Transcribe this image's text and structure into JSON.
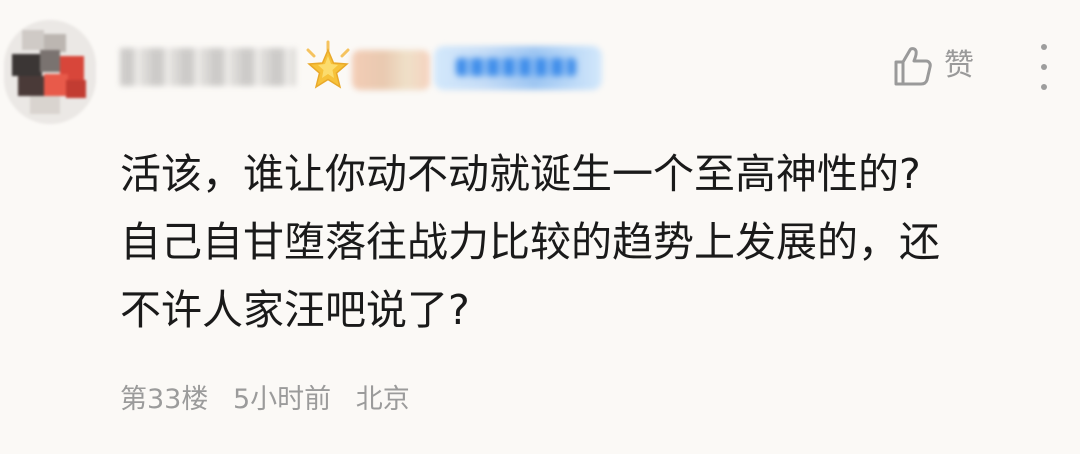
{
  "comment": {
    "username": "",
    "like_label": "赞",
    "content_lines": [
      "活该，谁让你动不动就诞生一个至高神性的?",
      "自己自甘堕落往战力比较的趋势上发展的，还",
      "不许人家汪吧说了?"
    ],
    "floor": "第33楼",
    "time": "5小时前",
    "location": "北京",
    "icons": {
      "like": "thumbs-up-icon",
      "more": "more-vertical-icon",
      "badge": "star-icon"
    },
    "colors": {
      "background": "#fbf9f6",
      "text": "#1a1a1a",
      "secondary": "#9b9b9b",
      "star": "#f7c23a",
      "vip": "#3d8cea"
    }
  }
}
